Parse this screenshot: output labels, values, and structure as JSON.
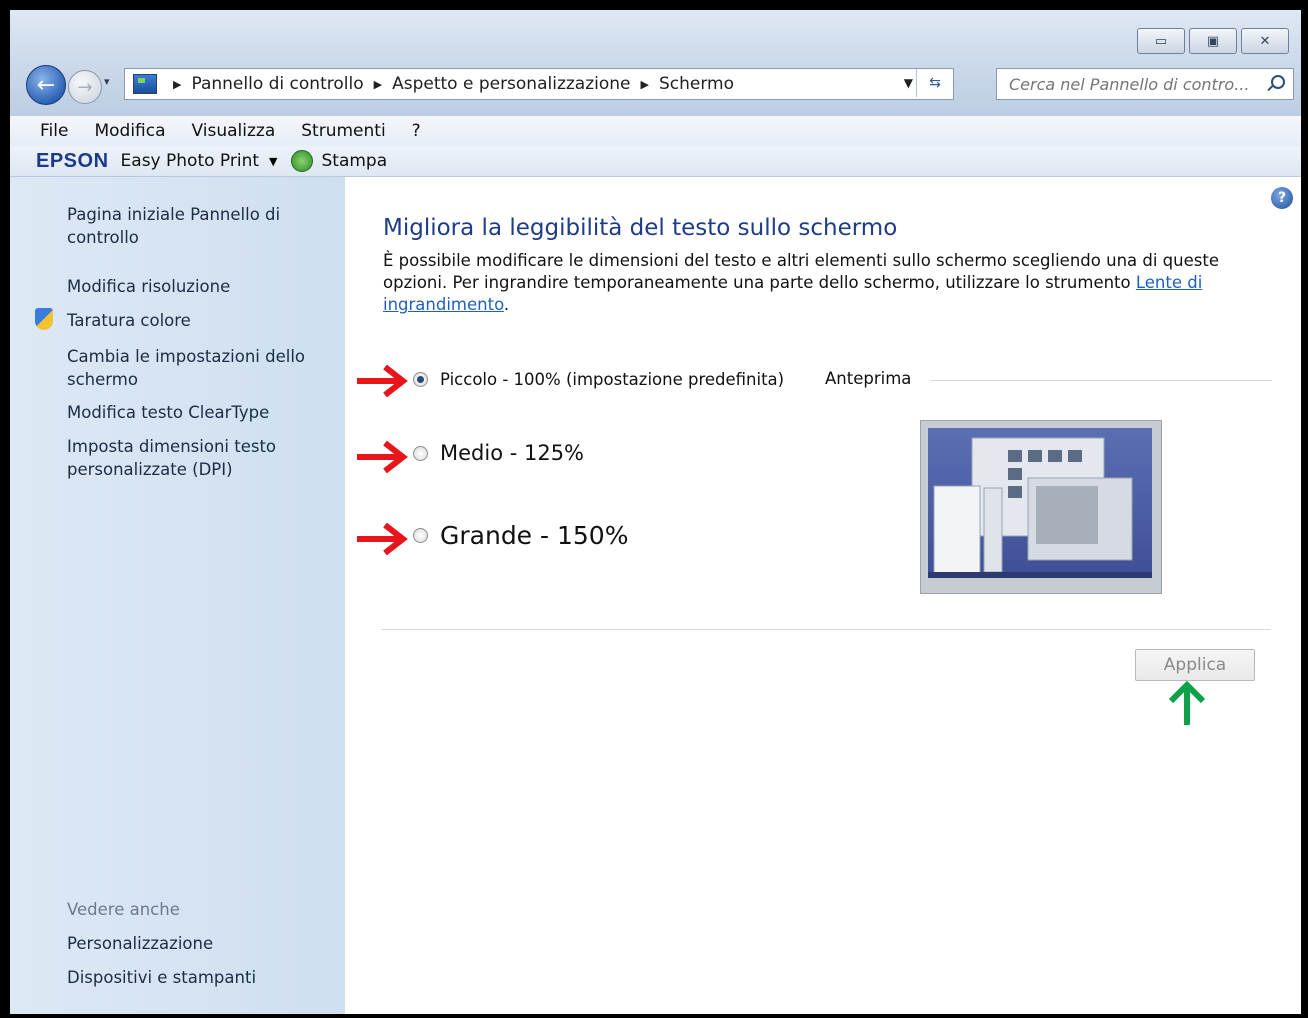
{
  "window": {
    "caption_buttons": [
      "minimize",
      "maximize",
      "close"
    ]
  },
  "nav": {
    "breadcrumb": [
      "Pannello di controllo",
      "Aspetto e personalizzazione",
      "Schermo"
    ],
    "search_placeholder": "Cerca nel Pannello di contro..."
  },
  "menu": {
    "items": [
      "File",
      "Modifica",
      "Visualizza",
      "Strumenti",
      "?"
    ]
  },
  "epson": {
    "logo": "EPSON",
    "app": "Easy Photo Print",
    "print": "Stampa"
  },
  "sidebar": {
    "links": [
      "Pagina iniziale Pannello di controllo",
      "Modifica risoluzione",
      "Taratura colore",
      "Cambia le impostazioni dello schermo",
      "Modifica testo ClearType",
      "Imposta dimensioni testo personalizzate (DPI)"
    ],
    "see_also_title": "Vedere anche",
    "see_also": [
      "Personalizzazione",
      "Dispositivi e stampanti"
    ]
  },
  "main": {
    "title": "Migliora la leggibilità del testo sullo schermo",
    "desc_prefix": "È possibile modificare le dimensioni del testo e altri elementi sullo schermo scegliendo una di queste opzioni. Per ingrandire temporaneamente una parte dello schermo, utilizzare lo strumento ",
    "desc_link": "Lente di ingrandimento",
    "desc_suffix": ".",
    "options": [
      {
        "label": "Piccolo - 100% (impostazione predefinita)",
        "checked": true
      },
      {
        "label": "Medio - 125%",
        "checked": false
      },
      {
        "label": "Grande - 150%",
        "checked": false
      }
    ],
    "preview_label": "Anteprima",
    "apply_label": "Applica"
  },
  "colors": {
    "annotation_red": "#e8161b",
    "annotation_green": "#0fa14a",
    "title_blue": "#1e3c88",
    "link_blue": "#1f5fbf"
  }
}
